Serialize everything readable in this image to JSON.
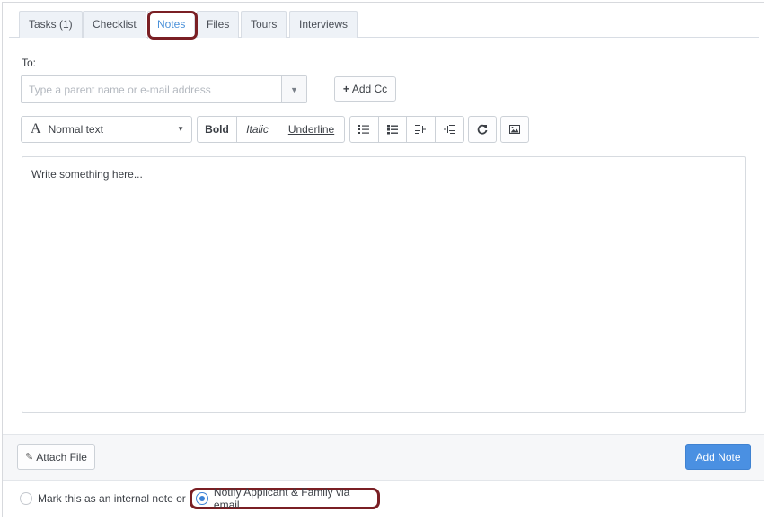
{
  "tabs": [
    {
      "label": "Tasks (1)"
    },
    {
      "label": "Checklist"
    },
    {
      "label": "Notes"
    },
    {
      "label": "Files"
    },
    {
      "label": "Tours"
    },
    {
      "label": "Interviews"
    }
  ],
  "active_tab": "Notes",
  "to_field": {
    "label": "To:",
    "value": "",
    "placeholder": "Type a parent name or e-mail address"
  },
  "add_cc_label": "Add Cc",
  "toolbar": {
    "text_style": "Normal text",
    "bold_label": "Bold",
    "italic_label": "Italic",
    "underline_label": "Underline"
  },
  "editor": {
    "placeholder": "Write something here..."
  },
  "footer": {
    "attach_label": "Attach File",
    "submit_label": "Add Note",
    "internal_note_label": "Mark this as an internal note or",
    "notify_label": "Notify Applicant & Family via email",
    "selected_option": "notify"
  },
  "colors": {
    "accent": "#4a90e2",
    "highlight_outline": "#7a1f24",
    "active_tab_text": "#4a90d9"
  }
}
